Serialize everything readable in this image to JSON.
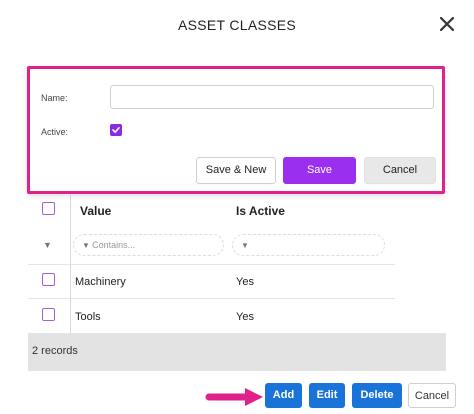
{
  "dialog": {
    "title": "ASSET CLASSES",
    "close_icon": "close-icon"
  },
  "form": {
    "name_label": "Name:",
    "name_value": "",
    "active_label": "Active:",
    "active_checked": true,
    "save_new_label": "Save & New",
    "save_label": "Save",
    "cancel_label": "Cancel",
    "highlight_color": "#e0218a",
    "save_color": "#9b2ff0"
  },
  "grid": {
    "columns": [
      "Value",
      "Is Active"
    ],
    "filter_placeholder": "Contains...",
    "rows": [
      {
        "value": "Machinery",
        "active": "Yes"
      },
      {
        "value": "Tools",
        "active": "Yes"
      }
    ],
    "record_count": "2 records"
  },
  "toolbar": {
    "add_label": "Add",
    "edit_label": "Edit",
    "delete_label": "Delete",
    "cancel_label": "Cancel",
    "primary_color": "#1a73d9"
  }
}
